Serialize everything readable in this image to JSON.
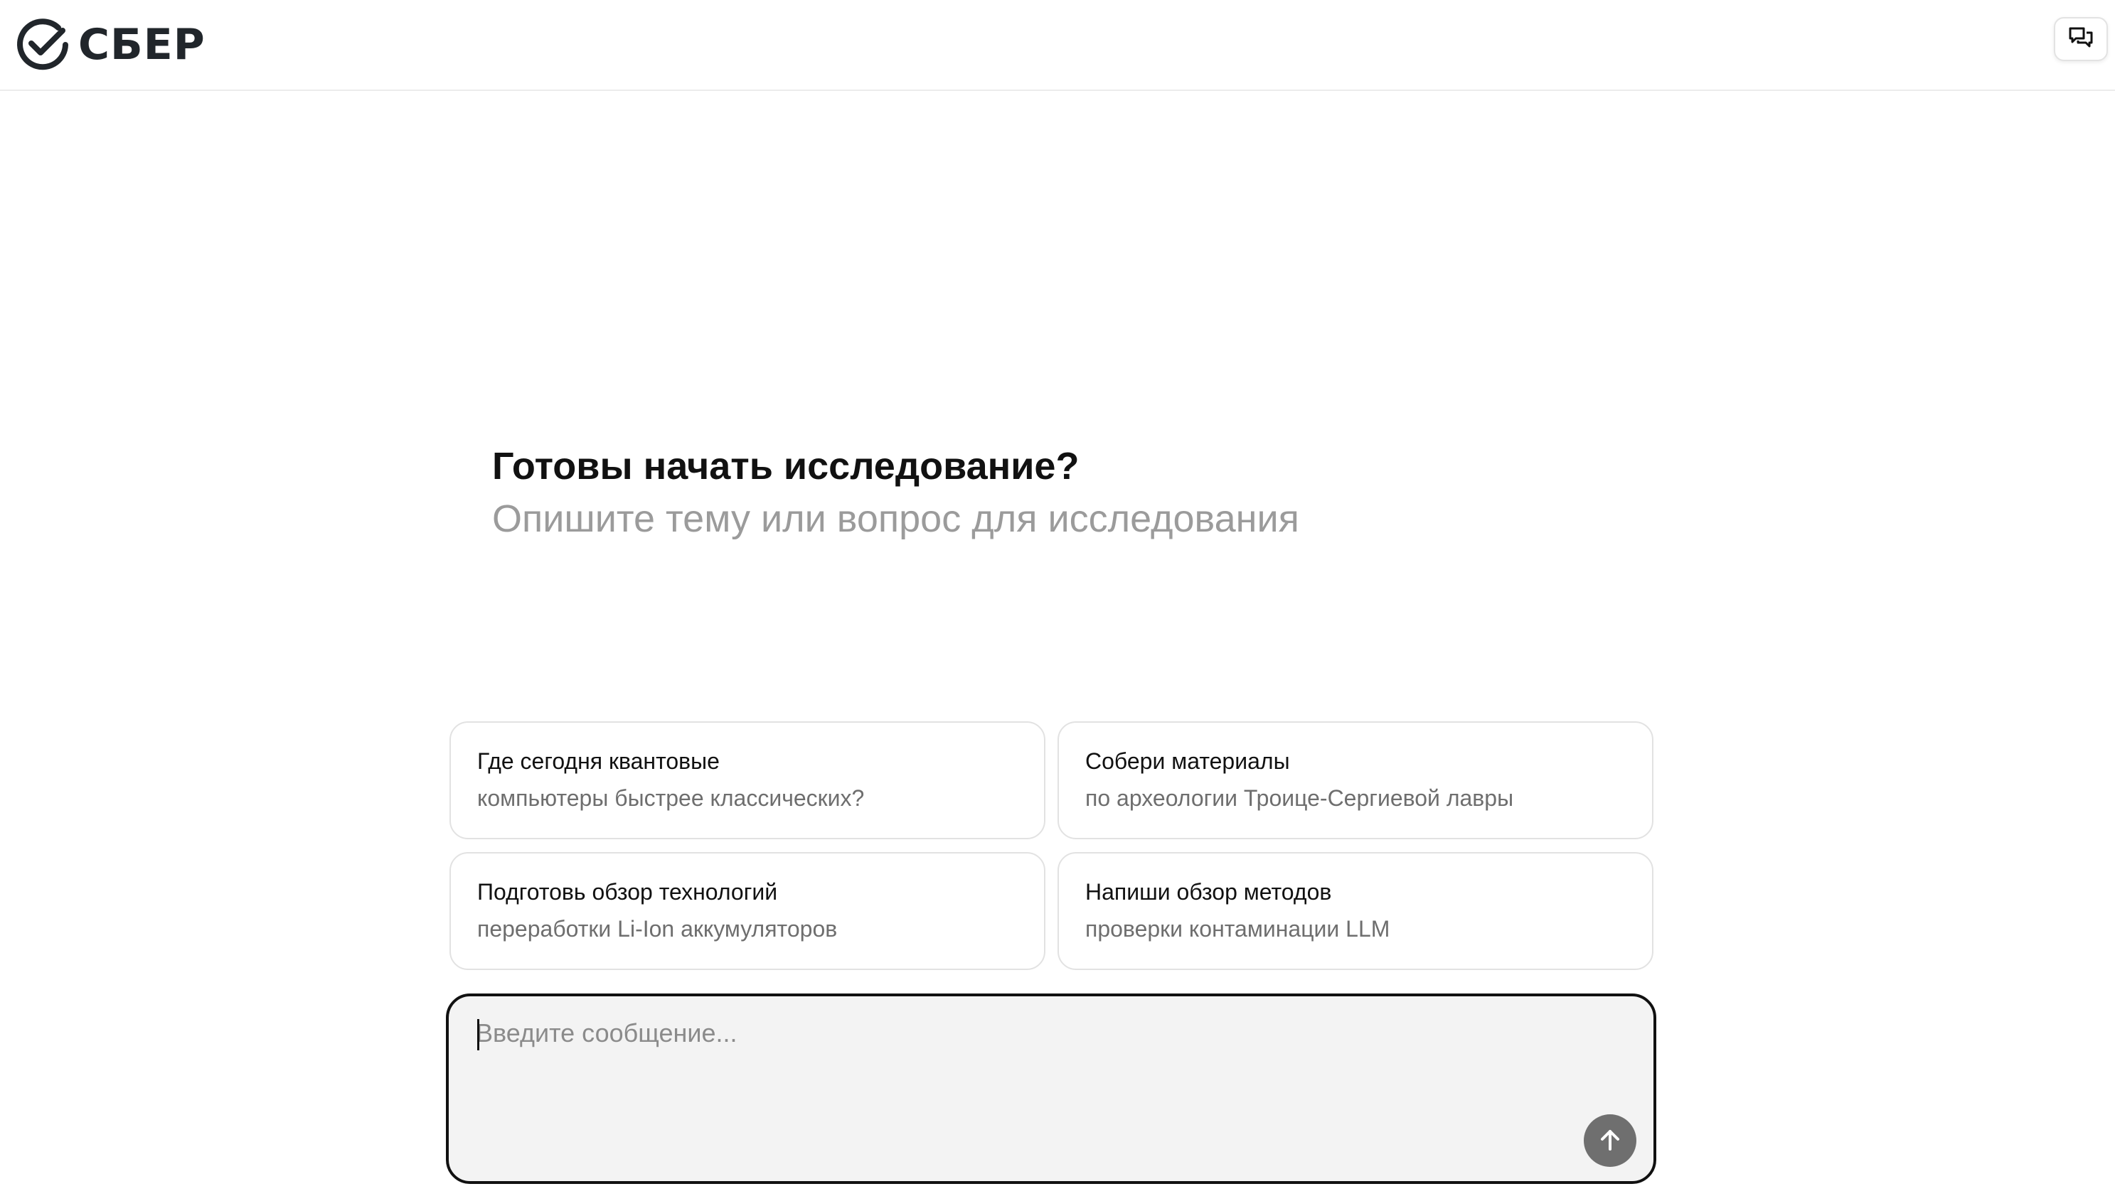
{
  "header": {
    "logo_text": "СБЕР",
    "logo_icon": "sber-check-icon",
    "chat_button_icon": "chat-bubbles-icon"
  },
  "hero": {
    "title": "Готовы начать исследование?",
    "subtitle": "Опишите тему или вопрос для исследования"
  },
  "suggestions": [
    {
      "title": "Где сегодня квантовые",
      "subtitle": "компьютеры быстрее классических?"
    },
    {
      "title": "Собери материалы",
      "subtitle": "по археологии Троице-Сергиевой лавры"
    },
    {
      "title": "Подготовь обзор технологий",
      "subtitle": "переработки Li-Ion аккумуляторов"
    },
    {
      "title": "Напиши обзор методов",
      "subtitle": "проверки контаминации LLM"
    }
  ],
  "composer": {
    "placeholder": "Введите сообщение...",
    "value": "",
    "send_icon": "arrow-up-icon"
  },
  "colors": {
    "border_accent": "#111111",
    "send_button": "#6f6f6f",
    "subtitle_text": "#9b9b9b"
  }
}
